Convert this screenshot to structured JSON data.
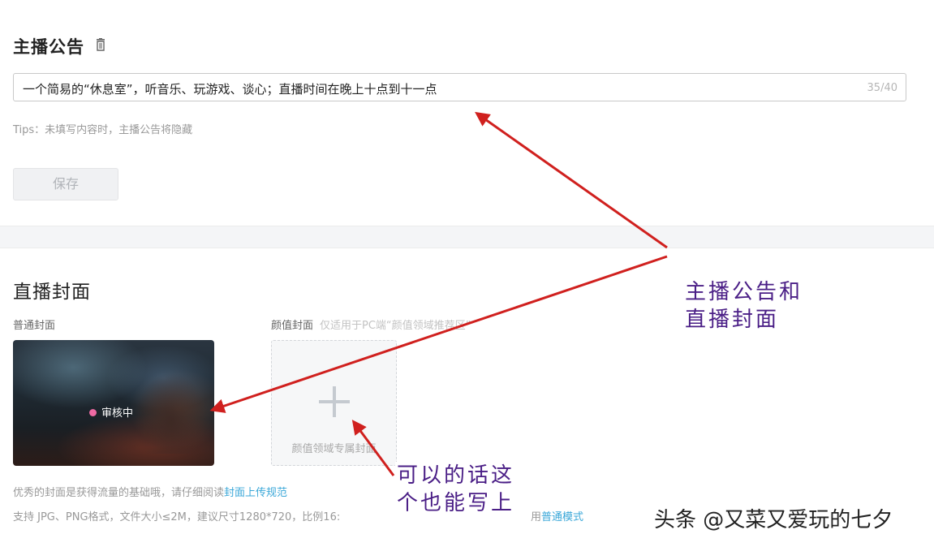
{
  "announcement": {
    "title": "主播公告",
    "input_value": "一个简易的“休息室”，听音乐、玩游戏、谈心；直播时间在晚上十点到十一点",
    "counter": "35/40",
    "tips": "Tips：未填写内容时，主播公告将隐藏",
    "save_label": "保存"
  },
  "cover": {
    "title": "直播封面",
    "normal_label": "普通封面",
    "beauty_label": "颜值封面",
    "beauty_hint": "仅适用于PC端“颜值领域推荐区”",
    "status": "审核中",
    "upload_label": "颜值领域专属封面",
    "info_text": "优秀的封面是获得流量的基础哦，请仔细阅读",
    "info_link": "封面上传规范",
    "specs": "支持 JPG、PNG格式，文件大小≤2M，建议尺寸1280*720，比例16:",
    "normal_mode_prefix": "用",
    "normal_mode_link": "普通模式"
  },
  "annotations": {
    "note_line1": "主播公告和",
    "note_line2": "直播封面",
    "note2_line1": "可以的话这",
    "note2_line2": "个也能写上",
    "watermark": "头条 @又菜又爱玩的七夕",
    "arrow_color": "#d0201e",
    "text_color": "#4a1e86"
  },
  "icons": {
    "delete": "trash-icon",
    "add": "plus-icon"
  }
}
